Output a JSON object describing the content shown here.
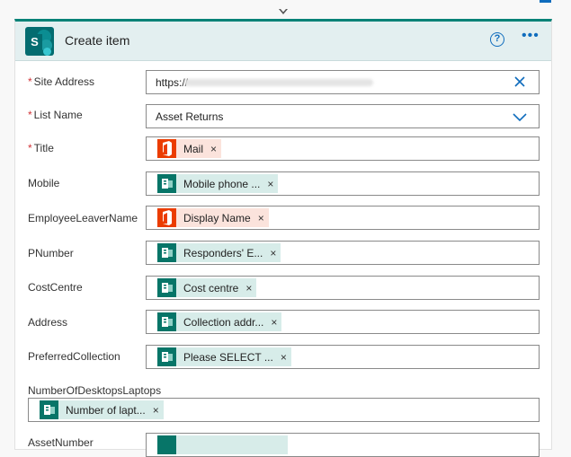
{
  "card": {
    "title": "Create item",
    "help_label": "?",
    "more_label": "•••"
  },
  "fields": {
    "site_address": {
      "label": "Site Address",
      "required": "*",
      "value": "https://"
    },
    "list_name": {
      "label": "List Name",
      "required": "*",
      "value": "Asset Returns"
    },
    "title": {
      "label": "Title",
      "required": "*",
      "token": "Mail",
      "token_source": "office"
    },
    "mobile": {
      "label": "Mobile",
      "token": "Mobile phone ...",
      "token_source": "forms"
    },
    "employee_leaver_name": {
      "label": "EmployeeLeaverName",
      "token": "Display Name",
      "token_source": "office"
    },
    "pnumber": {
      "label": "PNumber",
      "token": "Responders' E...",
      "token_source": "forms"
    },
    "cost_centre": {
      "label": "CostCentre",
      "token": "Cost centre",
      "token_source": "forms"
    },
    "address": {
      "label": "Address",
      "token": "Collection addr...",
      "token_source": "forms"
    },
    "preferred_collection": {
      "label": "PreferredCollection",
      "token": "Please SELECT ...",
      "token_source": "forms"
    },
    "number_of_desktops_laptops": {
      "label": "NumberOfDesktopsLaptops",
      "token": "Number of lapt...",
      "token_source": "forms"
    },
    "asset_number": {
      "label": "AssetNumber"
    }
  },
  "token_remove_label": "×",
  "colors": {
    "header_bg": "#e3eff0",
    "accent": "#088277",
    "link_blue": "#0f6cbd",
    "required_red": "#d13438",
    "office_token_bg": "#fbe3dc",
    "office_icon": "#eb3c00",
    "forms_token_bg": "#d7ece9",
    "forms_icon": "#077568"
  },
  "icons": {
    "card": "sharepoint-icon",
    "help": "help-circle-icon",
    "more": "more-ellipsis-icon",
    "clear": "close-icon",
    "dropdown": "chevron-down-icon",
    "office_token": "office-icon",
    "forms_token": "forms-icon"
  }
}
